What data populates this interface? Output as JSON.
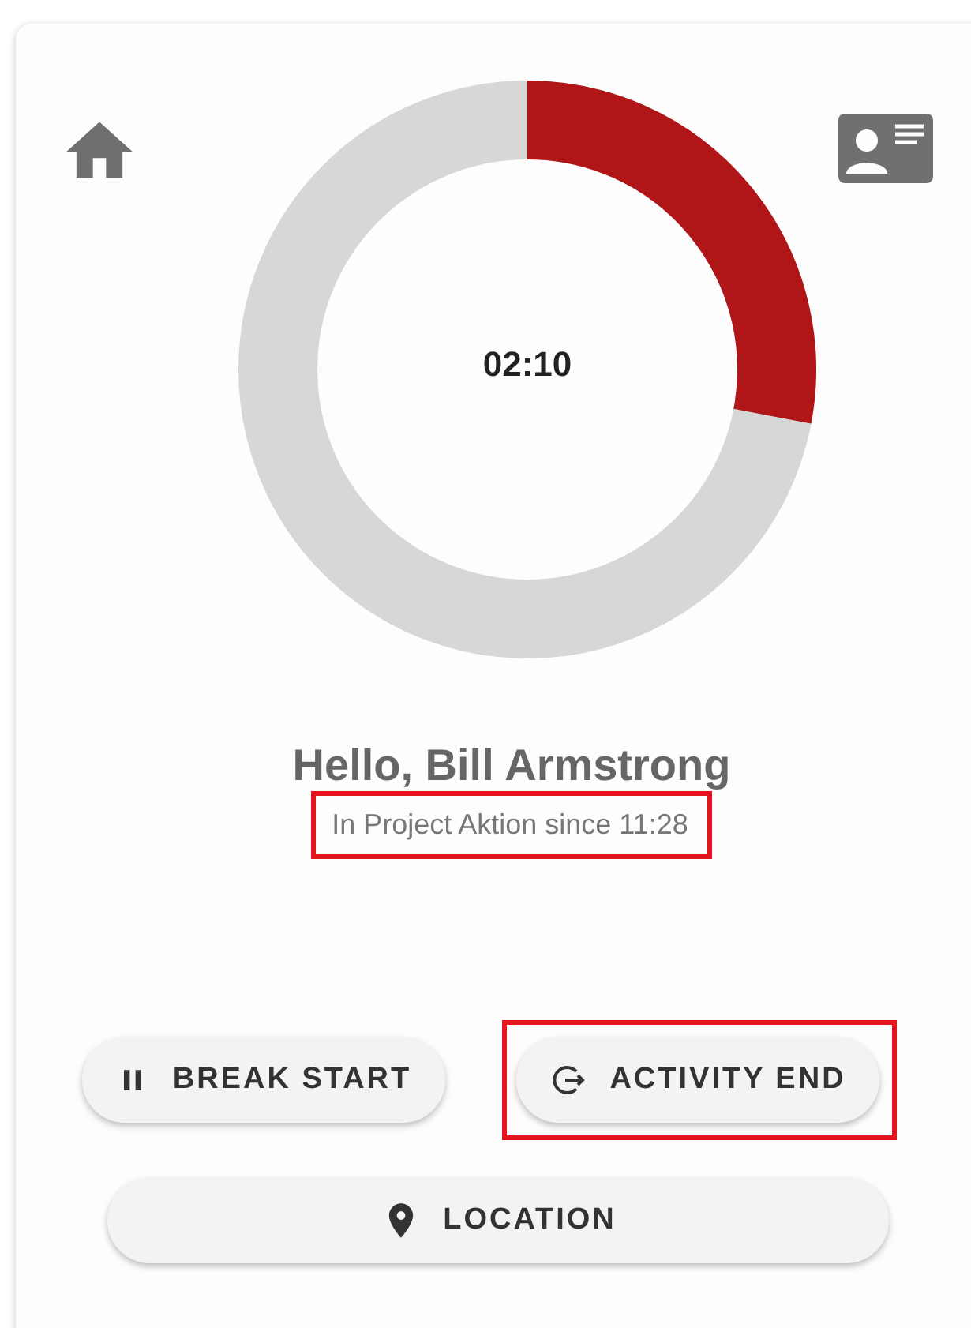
{
  "timer": {
    "display": "02:10"
  },
  "greeting": "Hello, Bill Armstrong",
  "status": {
    "text": "In Project Aktion since 11:28",
    "highlighted": true
  },
  "actions": [
    {
      "kind": "pause",
      "label": "BREAK START",
      "highlighted": false
    },
    {
      "kind": "end",
      "label": "ACTIVITY END",
      "highlighted": true
    }
  ],
  "location_button": {
    "kind": "location",
    "label": "LOCATION"
  }
}
